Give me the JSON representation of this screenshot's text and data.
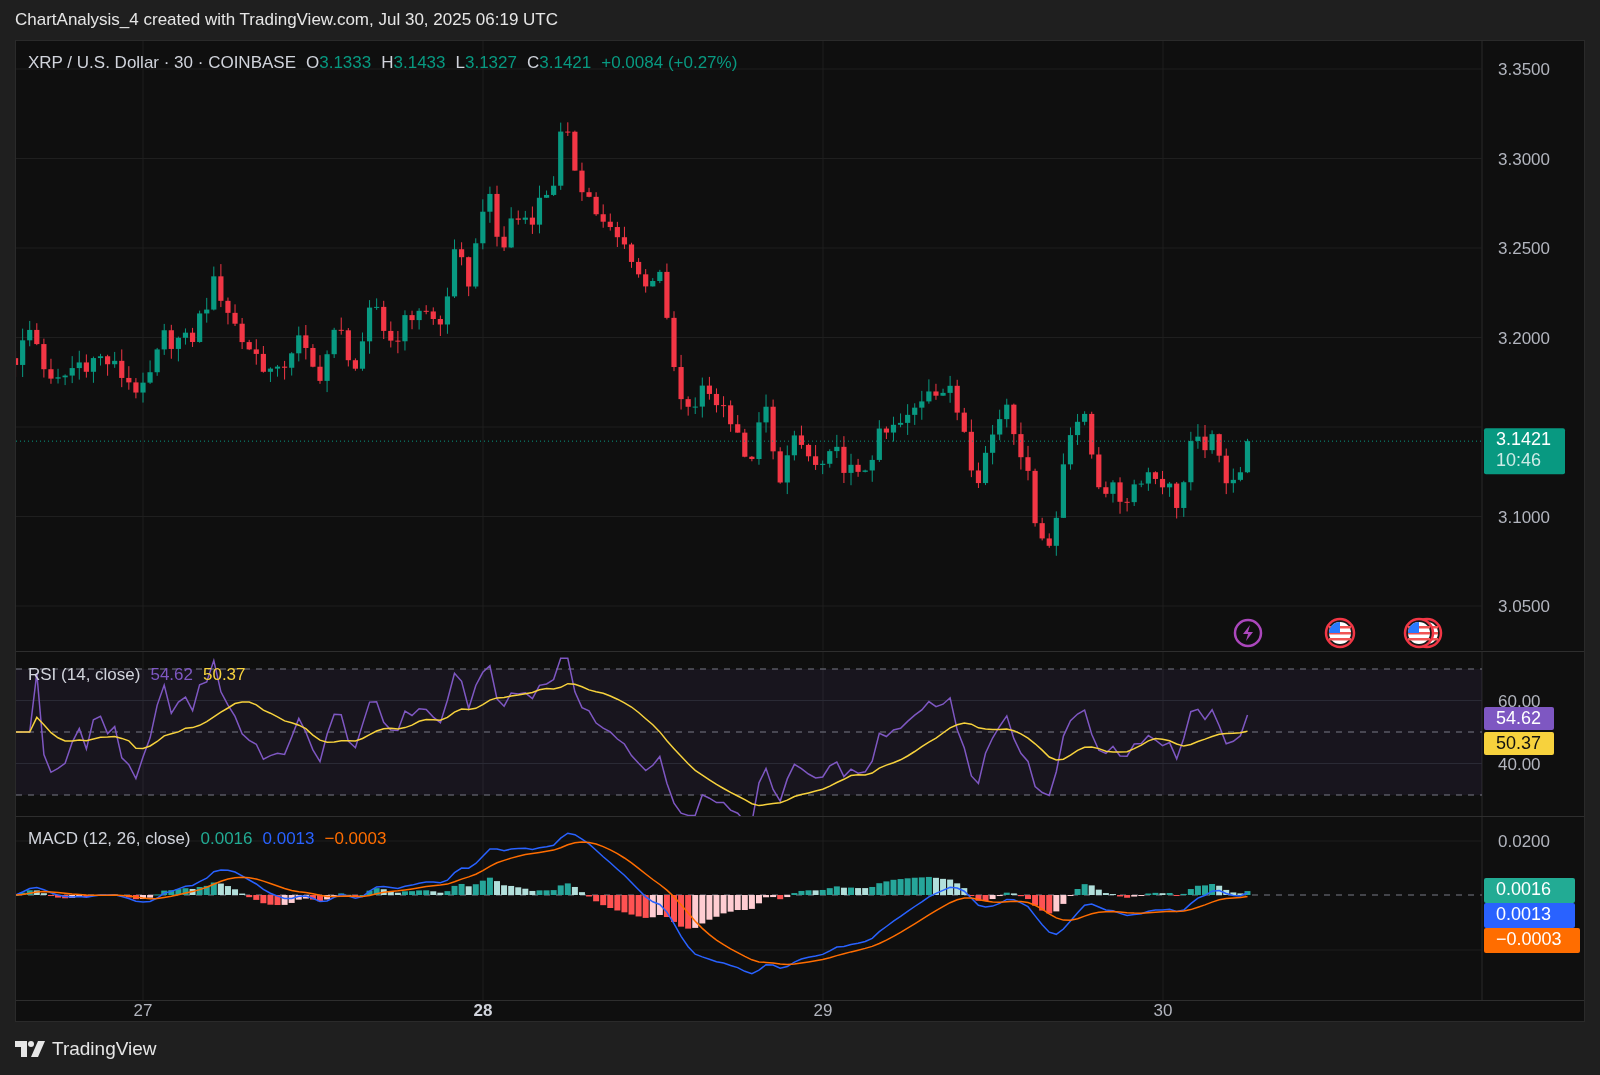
{
  "header": {
    "title": "ChartAnalysis_4 created with TradingView.com, Jul 30, 2025 06:19 UTC"
  },
  "price_pane": {
    "legend": {
      "symbol": "XRP / U.S. Dollar · 30 · COINBASE",
      "ohlc": [
        {
          "label": "O",
          "value": "3.1333"
        },
        {
          "label": "H",
          "value": "3.1433"
        },
        {
          "label": "L",
          "value": "3.1327"
        },
        {
          "label": "C",
          "value": "3.1421"
        }
      ],
      "change": "+0.0084 (+0.27%)"
    },
    "axis_labels": [
      "3.3500",
      "3.3000",
      "3.2500",
      "3.2000",
      "3.1000",
      "3.0500"
    ],
    "last_price": {
      "price": "3.1421",
      "countdown": "10:46"
    },
    "events": [
      {
        "kind": "lightning"
      },
      {
        "kind": "flag"
      },
      {
        "kind": "flag-stack"
      }
    ]
  },
  "rsi_pane": {
    "title": "RSI (14, close)",
    "values": [
      {
        "text": "54.62",
        "color": "#7e57c2"
      },
      {
        "text": "50.37",
        "color": "#f7d23d"
      }
    ],
    "axis_labels": [
      "60.00",
      "40.00"
    ],
    "tags": [
      {
        "text": "54.62",
        "color": "#7e57c2"
      },
      {
        "text": "50.37",
        "color": "#f7d23d"
      }
    ]
  },
  "macd_pane": {
    "title": "MACD (12, 26, close)",
    "values": [
      {
        "text": "0.0016",
        "color": "#22ab94"
      },
      {
        "text": "0.0013",
        "color": "#2962ff"
      },
      {
        "text": "−0.0003",
        "color": "#ff6d00"
      }
    ],
    "axis_labels": [
      "0.0200"
    ],
    "tags": [
      {
        "text": "0.0016",
        "color": "#22ab94"
      },
      {
        "text": "0.0013",
        "color": "#2962ff"
      },
      {
        "text": "−0.0003",
        "color": "#ff6d00"
      }
    ]
  },
  "time_axis": [
    {
      "label": "27",
      "emphasized": false
    },
    {
      "label": "28",
      "emphasized": true
    },
    {
      "label": "29",
      "emphasized": false
    },
    {
      "label": "30",
      "emphasized": false
    }
  ],
  "footer": {
    "brand": "TradingView"
  }
}
